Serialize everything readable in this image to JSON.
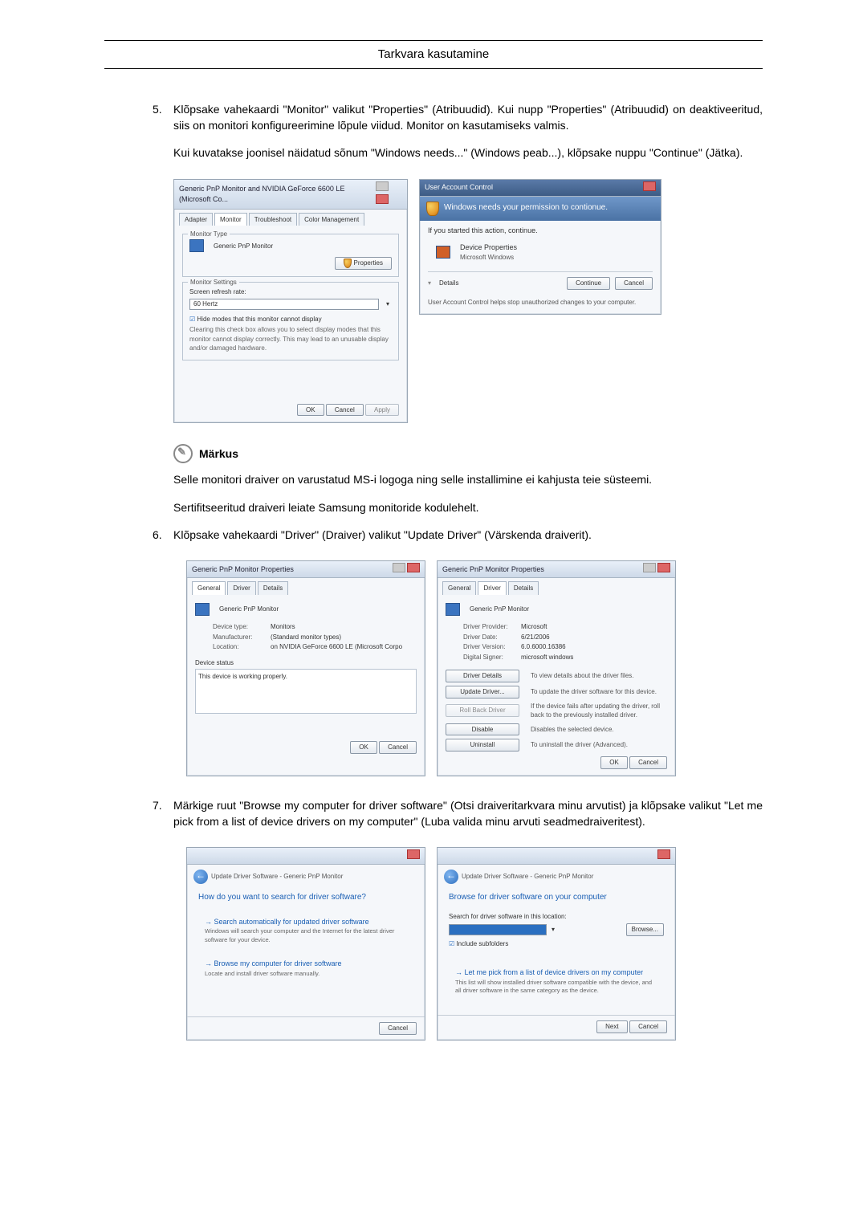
{
  "header": {
    "title": "Tarkvara kasutamine"
  },
  "step5": {
    "num": "5.",
    "p1": "Klõpsake vahekaardi \"Monitor\" valikut \"Properties\" (Atribuudid). Kui nupp \"Properties\" (Atribuudid) on deaktiveeritud, siis on monitori konfigureerimine lõpule viidud. Monitor on kasutamiseks valmis.",
    "p2": "Kui kuvatakse joonisel näidatud sõnum \"Windows needs...\" (Windows peab...), klõpsake nuppu \"Continue\" (Jätka)."
  },
  "monitor_dialog": {
    "title": "Generic PnP Monitor and NVIDIA GeForce 6600 LE (Microsoft Co...",
    "tabs": {
      "adapter": "Adapter",
      "monitor": "Monitor",
      "troubleshoot": "Troubleshoot",
      "color": "Color Management"
    },
    "type_legend": "Monitor Type",
    "type_name": "Generic PnP Monitor",
    "properties_btn": "Properties",
    "settings_legend": "Monitor Settings",
    "refresh_label": "Screen refresh rate:",
    "refresh_value": "60 Hertz",
    "hide_modes": "Hide modes that this monitor cannot display",
    "hide_modes_desc": "Clearing this check box allows you to select display modes that this monitor cannot display correctly. This may lead to an unusable display and/or damaged hardware.",
    "ok": "OK",
    "cancel": "Cancel",
    "apply": "Apply"
  },
  "uac": {
    "title": "User Account Control",
    "banner": "Windows needs your permission to contionue.",
    "line1": "If you started this action, continue.",
    "prog": "Device Properties",
    "pub": "Microsoft Windows",
    "details": "Details",
    "continue": "Continue",
    "cancel": "Cancel",
    "footer": "User Account Control helps stop unauthorized changes to your computer."
  },
  "note": {
    "label": "Märkus",
    "p1": "Selle monitori draiver on varustatud MS-i logoga ning selle installimine ei kahjusta teie süsteemi.",
    "p2": "Sertifitseeritud draiveri leiate Samsung monitoride kodulehelt."
  },
  "step6": {
    "num": "6.",
    "p1": "Klõpsake vahekaardi \"Driver\" (Draiver) valikut \"Update Driver\" (Värskenda draiverit)."
  },
  "prop_general": {
    "title": "Generic PnP Monitor Properties",
    "tabs": {
      "general": "General",
      "driver": "Driver",
      "details": "Details"
    },
    "name": "Generic PnP Monitor",
    "devtype_l": "Device type:",
    "devtype_v": "Monitors",
    "manu_l": "Manufacturer:",
    "manu_v": "(Standard monitor types)",
    "loc_l": "Location:",
    "loc_v": "on NVIDIA GeForce 6600 LE (Microsoft Corpo",
    "status_legend": "Device status",
    "status_text": "This device is working properly.",
    "ok": "OK",
    "cancel": "Cancel"
  },
  "prop_driver": {
    "title": "Generic PnP Monitor Properties",
    "tabs": {
      "general": "General",
      "driver": "Driver",
      "details": "Details"
    },
    "name": "Generic PnP Monitor",
    "prov_l": "Driver Provider:",
    "prov_v": "Microsoft",
    "date_l": "Driver Date:",
    "date_v": "6/21/2006",
    "ver_l": "Driver Version:",
    "ver_v": "6.0.6000.16386",
    "sig_l": "Digital Signer:",
    "sig_v": "microsoft windows",
    "details_btn": "Driver Details",
    "details_d": "To view details about the driver files.",
    "update_btn": "Update Driver...",
    "update_d": "To update the driver software for this device.",
    "rollback_btn": "Roll Back Driver",
    "rollback_d": "If the device fails after updating the driver, roll back to the previously installed driver.",
    "disable_btn": "Disable",
    "disable_d": "Disables the selected device.",
    "uninstall_btn": "Uninstall",
    "uninstall_d": "To uninstall the driver (Advanced).",
    "ok": "OK",
    "cancel": "Cancel"
  },
  "step7": {
    "num": "7.",
    "p1": "Märkige ruut \"Browse my computer for driver software\" (Otsi draiveritarkvara minu arvutist) ja klõpsake valikut \"Let me pick from a list of device drivers on my computer\" (Luba valida minu arvuti seadmedraiveritest)."
  },
  "wiz1": {
    "crumb": "Update Driver Software - Generic PnP Monitor",
    "heading": "How do you want to search for driver software?",
    "opt1_t": "Search automatically for updated driver software",
    "opt1_d": "Windows will search your computer and the Internet for the latest driver software for your device.",
    "opt2_t": "Browse my computer for driver software",
    "opt2_d": "Locate and install driver software manually.",
    "cancel": "Cancel"
  },
  "wiz2": {
    "crumb": "Update Driver Software - Generic PnP Monitor",
    "heading": "Browse for driver software on your computer",
    "search_l": "Search for driver software in this location:",
    "browse": "Browse...",
    "include": "Include subfolders",
    "opt_t": "Let me pick from a list of device drivers on my computer",
    "opt_d": "This list will show installed driver software compatible with the device, and all driver software in the same category as the device.",
    "next": "Next",
    "cancel": "Cancel"
  }
}
